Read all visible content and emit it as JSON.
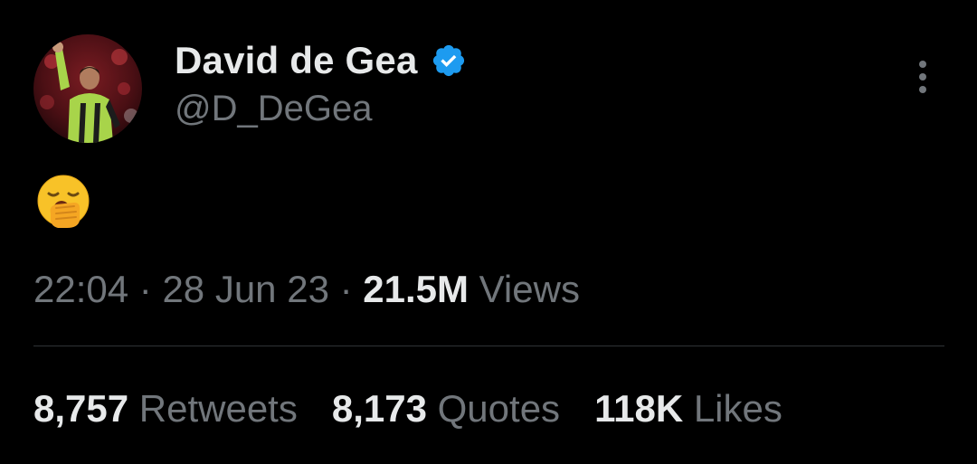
{
  "author": {
    "display_name": "David de Gea",
    "handle": "@D_DeGea",
    "verified_color": "#1d9bf0",
    "avatar_icon": "profile-photo"
  },
  "tweet": {
    "body_emoji_icon": "yawning-face-emoji",
    "time": "22:04",
    "separator": " · ",
    "date": "28 Jun 23",
    "views_count": "21.5M",
    "views_label": " Views"
  },
  "stats": [
    {
      "count": "8,757",
      "label": " Retweets"
    },
    {
      "count": "8,173",
      "label": " Quotes"
    },
    {
      "count": "118K",
      "label": " Likes"
    }
  ],
  "colors": {
    "background": "#000000",
    "primary_text": "#e7e9ea",
    "secondary_text": "#71767b",
    "divider": "#2f3336"
  }
}
